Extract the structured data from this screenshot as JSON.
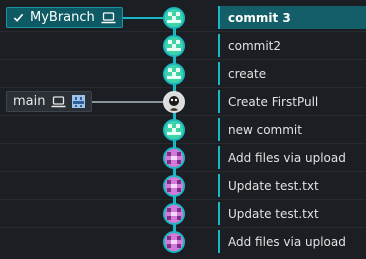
{
  "branches": [
    {
      "name": "MyBranch",
      "checked": true,
      "icon": "laptop-icon"
    },
    {
      "name": "main",
      "icons": [
        "laptop-icon",
        "remote-avatar-icon"
      ]
    }
  ],
  "commits": [
    {
      "message": "commit 3",
      "avatar": "green-identicon",
      "selected": true
    },
    {
      "message": "commit2",
      "avatar": "green-identicon"
    },
    {
      "message": "create",
      "avatar": "green-identicon"
    },
    {
      "message": "Create FirstPull",
      "avatar": "user-photo-avatar"
    },
    {
      "message": "new commit",
      "avatar": "green-identicon"
    },
    {
      "message": "Add files via upload",
      "avatar": "purple-identicon"
    },
    {
      "message": "Update test.txt",
      "avatar": "purple-identicon"
    },
    {
      "message": "Update test.txt",
      "avatar": "purple-identicon"
    },
    {
      "message": "Add files via upload",
      "avatar": "purple-identicon"
    }
  ],
  "colors": {
    "background": "#1b1e22",
    "graph_line": "#19b8c4",
    "selected_row": "#135e68",
    "identicon_green": "#3fd3a6",
    "identicon_purple": "#d27ad8"
  }
}
